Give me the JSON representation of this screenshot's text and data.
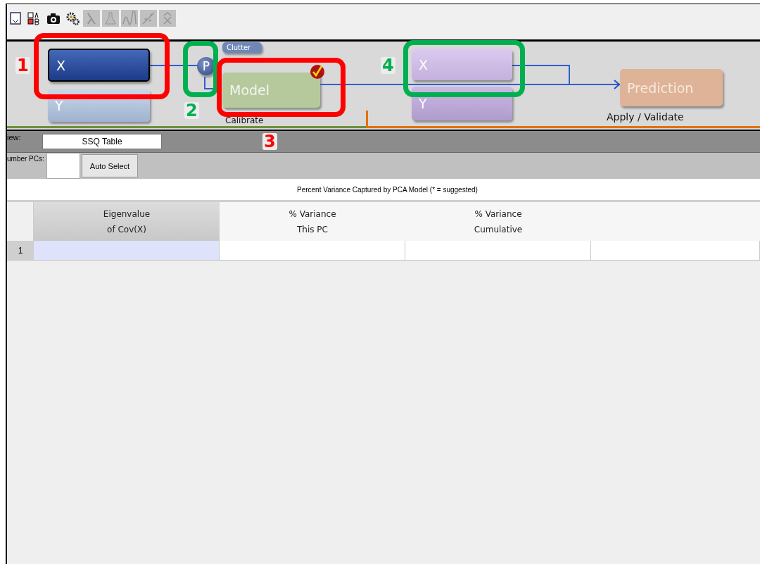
{
  "toolbar": {
    "buttons": [
      {
        "kind": "window",
        "disabled": false
      },
      {
        "kind": "checkbox-ab",
        "disabled": false
      },
      {
        "kind": "camera",
        "disabled": false
      },
      {
        "kind": "gears",
        "disabled": false
      },
      {
        "kind": "lambda",
        "disabled": true
      },
      {
        "kind": "flask",
        "disabled": true
      },
      {
        "kind": "peaks",
        "disabled": true
      },
      {
        "kind": "scatter",
        "disabled": true
      },
      {
        "kind": "xhat",
        "disabled": true
      }
    ]
  },
  "flow": {
    "data_x": {
      "label": "X",
      "selected": true
    },
    "data_y": {
      "label": "Y",
      "selected": false
    },
    "preprocess_badge": "P",
    "clutter": "Clutter",
    "model": {
      "label": "Model",
      "calibrated": true
    },
    "calibrate_label": "Calibrate",
    "validation_x": {
      "label": "X"
    },
    "validation_y": {
      "label": "Y"
    },
    "prediction": "Prediction",
    "apply_label": "Apply / Validate"
  },
  "annotations": [
    {
      "number": "1",
      "color": "#ff0000"
    },
    {
      "number": "2",
      "color": "#00b050"
    },
    {
      "number": "3",
      "color": "#ff0000"
    },
    {
      "number": "4",
      "color": "#00b050"
    }
  ],
  "view": {
    "label": "iew:",
    "value": "SSQ Table"
  },
  "pcs": {
    "label": "umber PCs:",
    "button": "Auto Select"
  },
  "caption": "Percent Variance Captured by PCA Model (* = suggested)",
  "table": {
    "columns": [
      "Eigenvalue\nof Cov(X)",
      "% Variance\nThis PC",
      "% Variance\nCumulative"
    ],
    "rows": [
      {
        "label": "1",
        "cells": [
          {
            "selected": true
          },
          {
            "selected": false
          },
          {
            "selected": false
          },
          {
            "selected": false
          }
        ]
      }
    ]
  }
}
